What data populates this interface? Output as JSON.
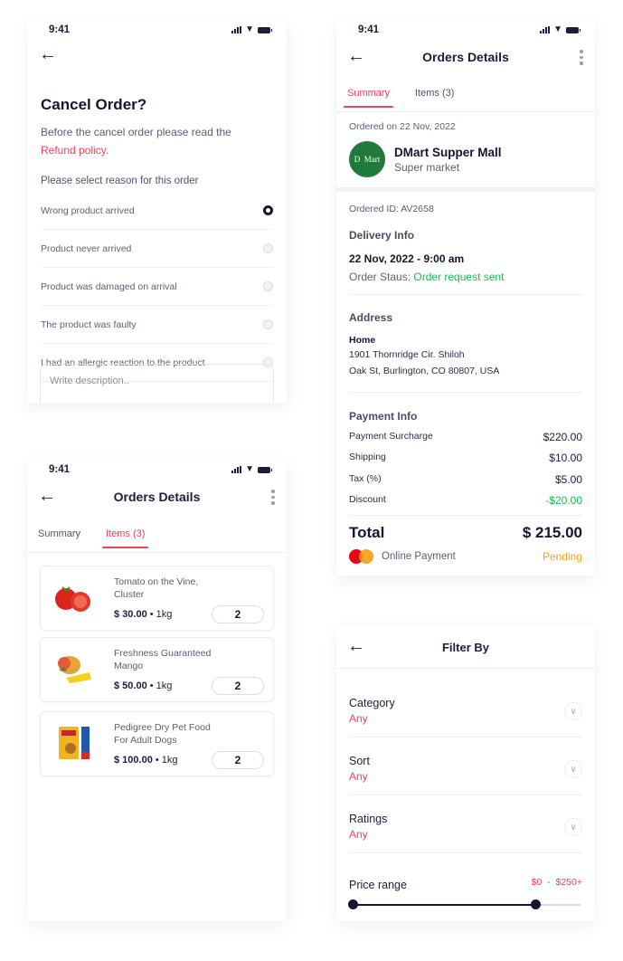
{
  "status_bar": {
    "time": "9:41"
  },
  "cancel_order": {
    "title": "Cancel Order?",
    "intro_text": "Before the cancel order please read the",
    "refund_link": "Refund policy",
    "intro_suffix": ".",
    "reason_label": "Please select reason for this order",
    "reasons": [
      {
        "label": "Wrong product arrived",
        "selected": true
      },
      {
        "label": "Product never arrived",
        "selected": false
      },
      {
        "label": "Product was damaged on arrival",
        "selected": false
      },
      {
        "label": "The product was faulty",
        "selected": false
      },
      {
        "label": "I had an allergic reaction to the product",
        "selected": false
      }
    ],
    "description_placeholder": "Write description.."
  },
  "order_summary": {
    "title": "Orders Details",
    "tabs": [
      "Summary",
      "Items (3)"
    ],
    "active_tab": "Summary",
    "ordered_on": "Ordered on 22 Nov, 2022",
    "store": {
      "logo_text": "D Mart",
      "name": "DMart Supper Mall",
      "type": "Super market"
    },
    "order_id": "Ordered ID: AV2658",
    "delivery_title": "Delivery Info",
    "delivery_datetime": "22 Nov, 2022 - 9:00 am",
    "status_label": "Order Staus:",
    "status_value": "Order request sent",
    "address_title": "Address",
    "address_type": "Home",
    "address_line1": "1901 Thornridge Cir. Shiloh",
    "address_line2": "Oak St, Burlington, CO 80807, USA",
    "payment_title": "Payment Info",
    "payment_rows": [
      {
        "label": "Payment Surcharge",
        "amount": "$220.00"
      },
      {
        "label": "Shipping",
        "amount": "$10.00"
      },
      {
        "label": "Tax (%)",
        "amount": "$5.00"
      },
      {
        "label": "Discount",
        "amount": "-$20.00"
      }
    ],
    "total_label": "Total",
    "total_amount": "$ 215.00",
    "payment_method": "Online Payment",
    "payment_status": "Pending",
    "colors": {
      "accent": "#e8445a",
      "success": "#1db954",
      "pending": "#f5a623"
    }
  },
  "order_items": {
    "title": "Orders Details",
    "tabs": [
      "Summary",
      "Items (3)"
    ],
    "active_tab": "Items (3)",
    "items": [
      {
        "name": "Tomato on the Vine, Cluster",
        "price": "$ 30.00",
        "unit": "1kg",
        "qty": "2",
        "icon": "tomato-image"
      },
      {
        "name": "Freshness Guaranteed Mango",
        "price": "$ 50.00",
        "unit": "1kg",
        "qty": "2",
        "icon": "mango-image"
      },
      {
        "name": "Pedigree Dry Pet Food For Adult Dogs",
        "price": "$ 100.00",
        "unit": "1kg",
        "qty": "2",
        "icon": "dog-food-image"
      }
    ]
  },
  "filter": {
    "title": "Filter By",
    "rows": [
      {
        "label": "Category",
        "value": "Any"
      },
      {
        "label": "Sort",
        "value": "Any"
      },
      {
        "label": "Ratings",
        "value": "Any"
      }
    ],
    "price_label": "Price range",
    "price_range_text": "$0  -  $250+",
    "price_slider": {
      "min_fraction": 0.0,
      "max_fraction": 0.8
    }
  }
}
